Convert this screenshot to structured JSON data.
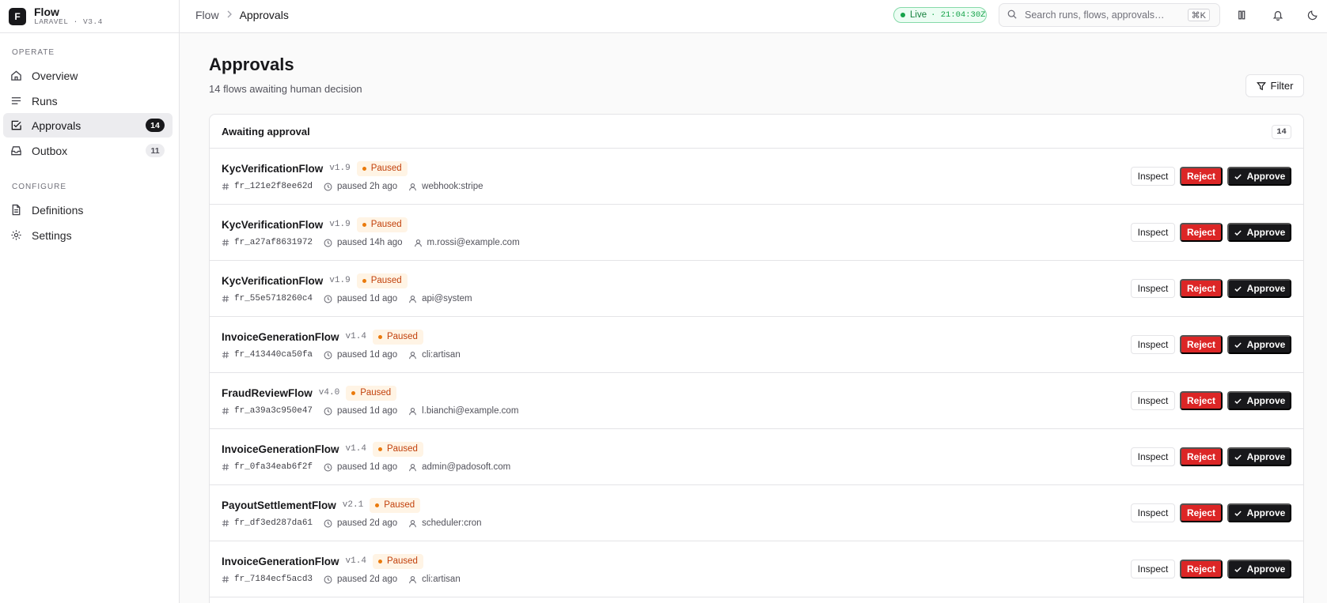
{
  "brand": {
    "logo_letter": "F",
    "name": "Flow",
    "version": "LARAVEL · V3.4"
  },
  "sidebar": {
    "sections": [
      {
        "label": "OPERATE"
      },
      {
        "label": "CONFIGURE"
      }
    ],
    "items": [
      {
        "label": "Overview",
        "icon": "home-icon"
      },
      {
        "label": "Runs",
        "icon": "list-icon"
      },
      {
        "label": "Approvals",
        "icon": "check-square-icon",
        "badge": "14",
        "active": true
      },
      {
        "label": "Outbox",
        "icon": "inbox-icon",
        "badge": "11"
      },
      {
        "label": "Definitions",
        "icon": "file-icon"
      },
      {
        "label": "Settings",
        "icon": "gear-icon"
      }
    ]
  },
  "topbar": {
    "breadcrumb": [
      "Flow",
      "Approvals"
    ],
    "live_label": "Live",
    "live_time": "· 21:04:30Z",
    "search_placeholder": "Search runs, flows, approvals…",
    "search_shortcut": "⌘K"
  },
  "page": {
    "title": "Approvals",
    "subtitle": "14 flows awaiting human decision",
    "filter_label": "Filter"
  },
  "card": {
    "title": "Awaiting approval",
    "count": "14",
    "rows": [
      {
        "flow": "KycVerificationFlow",
        "version": "v1.9",
        "status": "Paused",
        "run_id": "fr_121e2f8ee62d",
        "paused": "paused 2h ago",
        "actor": "webhook:stripe"
      },
      {
        "flow": "KycVerificationFlow",
        "version": "v1.9",
        "status": "Paused",
        "run_id": "fr_a27af8631972",
        "paused": "paused 14h ago",
        "actor": "m.rossi@example.com"
      },
      {
        "flow": "KycVerificationFlow",
        "version": "v1.9",
        "status": "Paused",
        "run_id": "fr_55e5718260c4",
        "paused": "paused 1d ago",
        "actor": "api@system"
      },
      {
        "flow": "InvoiceGenerationFlow",
        "version": "v1.4",
        "status": "Paused",
        "run_id": "fr_413440ca50fa",
        "paused": "paused 1d ago",
        "actor": "cli:artisan"
      },
      {
        "flow": "FraudReviewFlow",
        "version": "v4.0",
        "status": "Paused",
        "run_id": "fr_a39a3c950e47",
        "paused": "paused 1d ago",
        "actor": "l.bianchi@example.com"
      },
      {
        "flow": "InvoiceGenerationFlow",
        "version": "v1.4",
        "status": "Paused",
        "run_id": "fr_0fa34eab6f2f",
        "paused": "paused 1d ago",
        "actor": "admin@padosoft.com"
      },
      {
        "flow": "PayoutSettlementFlow",
        "version": "v2.1",
        "status": "Paused",
        "run_id": "fr_df3ed287da61",
        "paused": "paused 2d ago",
        "actor": "scheduler:cron"
      },
      {
        "flow": "InvoiceGenerationFlow",
        "version": "v1.4",
        "status": "Paused",
        "run_id": "fr_7184ecf5acd3",
        "paused": "paused 2d ago",
        "actor": "cli:artisan"
      }
    ],
    "actions": {
      "inspect": "Inspect",
      "reject": "Reject",
      "approve": "Approve"
    }
  },
  "colors": {
    "accent": "#18181b",
    "reject": "#dc2626",
    "paused": "#c2410c",
    "live": "#16a34a"
  }
}
